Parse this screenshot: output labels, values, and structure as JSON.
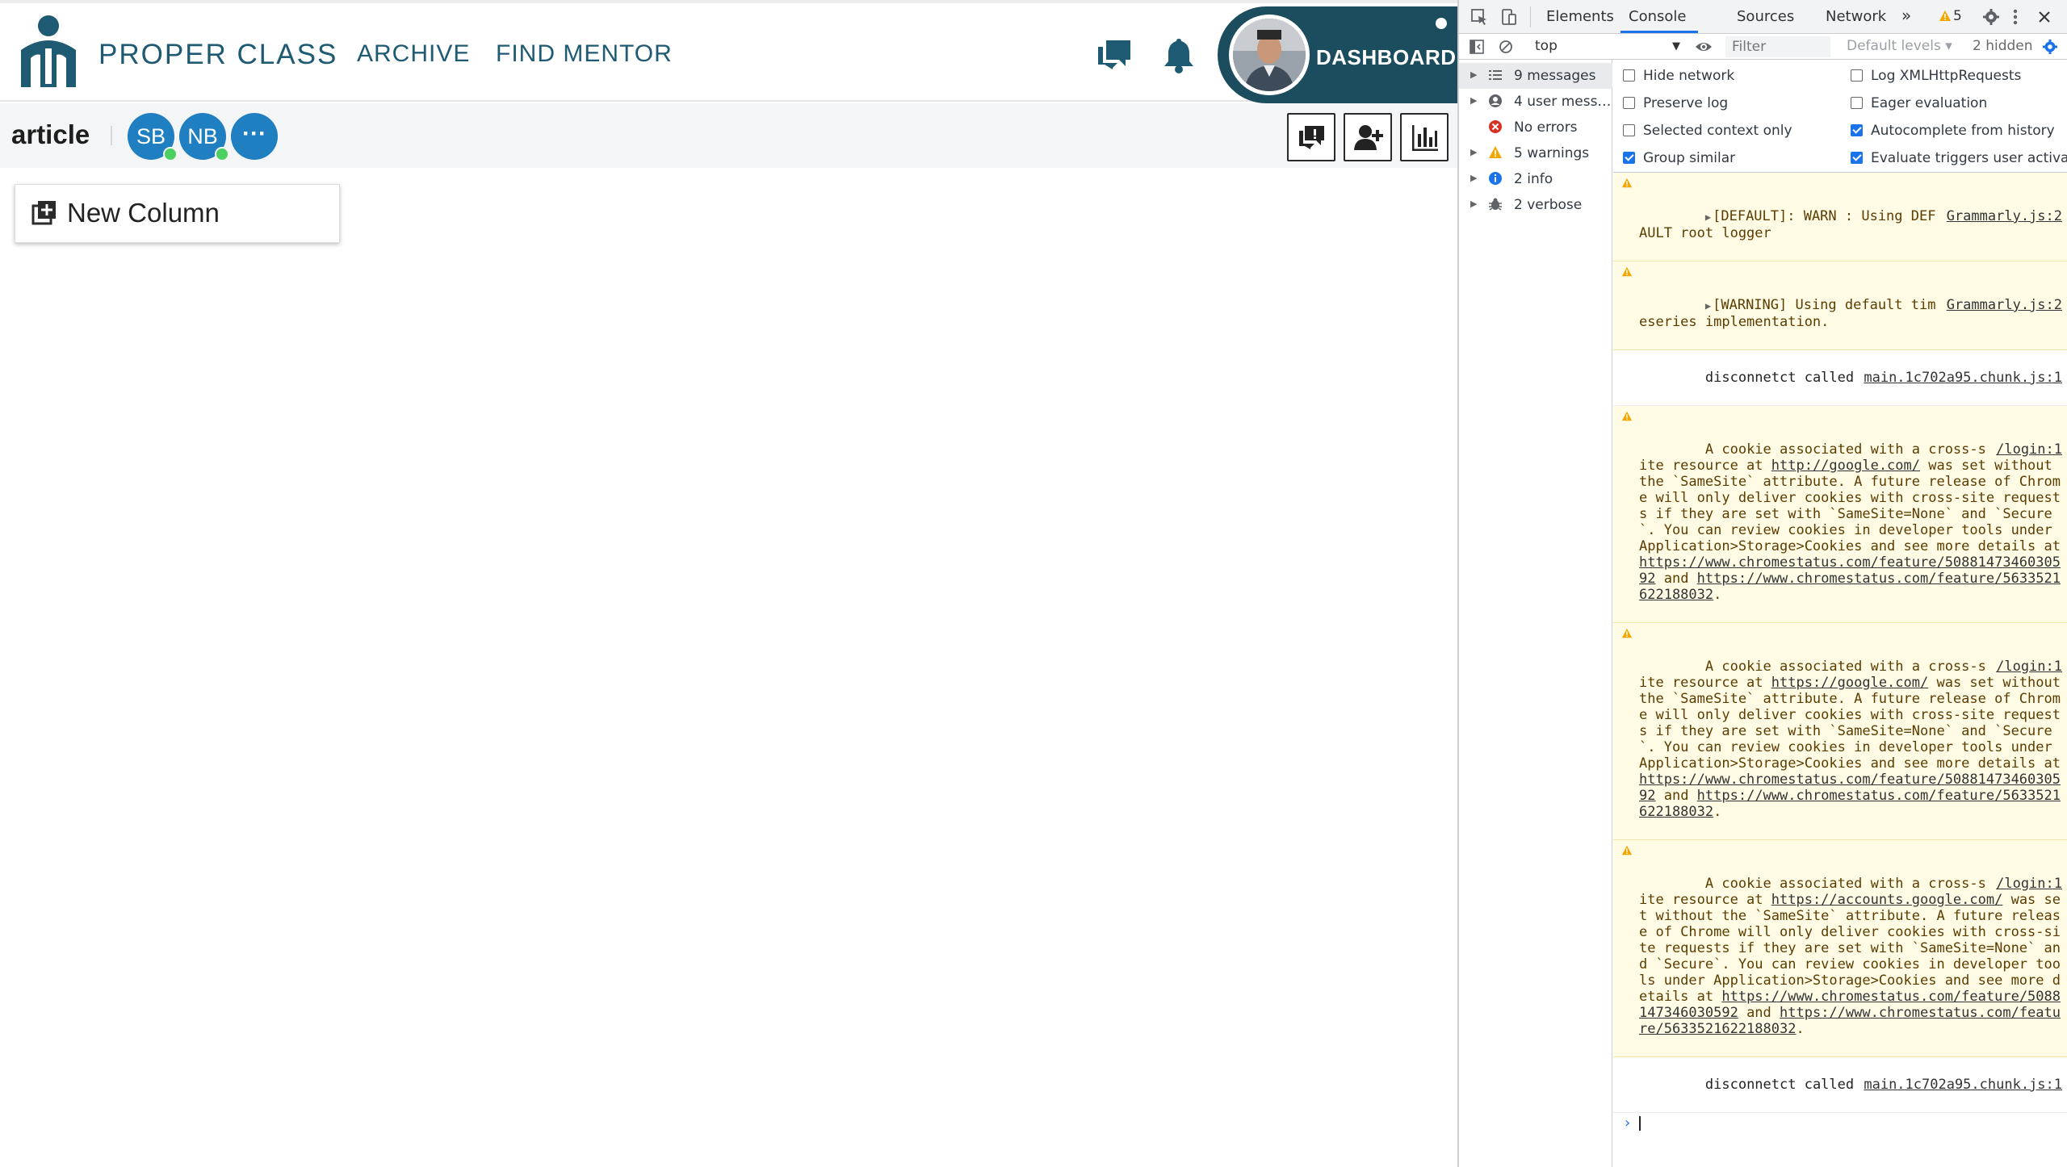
{
  "app": {
    "brand": "PROPER CLASS",
    "nav": {
      "archive": "ARCHIVE",
      "find_mentor": "FIND MENTOR"
    },
    "dashboard_label": "DASHBOARD",
    "article_title": "article",
    "members": [
      {
        "initials": "SB",
        "online": true
      },
      {
        "initials": "NB",
        "online": true
      }
    ],
    "more_members": "···",
    "new_column_label": "New Column",
    "colors": {
      "brand": "#1f5a73",
      "dashboard_bg": "#1c4d5e",
      "member_avatar": "#1f7fc0",
      "online": "#4ccf63"
    }
  },
  "devtools": {
    "tabs": [
      "Elements",
      "Console",
      "Sources",
      "Network",
      "»"
    ],
    "active_tab": "Console",
    "warning_badge": "5",
    "context": "top",
    "filter_placeholder": "Filter",
    "levels": "Default levels ▾",
    "hidden": "2 hidden",
    "sidebar": [
      {
        "label": "9 messages",
        "icon": "list-icon"
      },
      {
        "label": "4 user mess…",
        "icon": "user-icon"
      },
      {
        "label": "No errors",
        "icon": "error-icon"
      },
      {
        "label": "5 warnings",
        "icon": "warning-icon"
      },
      {
        "label": "2 info",
        "icon": "info-icon"
      },
      {
        "label": "2 verbose",
        "icon": "bug-icon"
      }
    ],
    "settings": {
      "hide_network": "Hide network",
      "preserve_log": "Preserve log",
      "selected_context": "Selected context only",
      "group_similar": "Group similar",
      "log_xhr": "Log XMLHttpRequests",
      "eager_eval": "Eager evaluation",
      "autocomplete": "Autocomplete from history",
      "evaluate_triggers": "Evaluate triggers user activatio"
    },
    "messages": [
      {
        "level": "warn",
        "expandable": true,
        "text": "[DEFAULT]: WARN : Using DEFAULT root logger",
        "source": "Grammarly.js:2"
      },
      {
        "level": "warn",
        "expandable": true,
        "text": "[WARNING] Using default timeseries implementation.",
        "source": "Grammarly.js:2"
      },
      {
        "level": "log",
        "text": "disconnetct called",
        "source": "main.1c702a95.chunk.js:1"
      },
      {
        "level": "warn",
        "text_a": "A cookie associated with a cross-site resource at ",
        "link": "http://google.com/",
        "text_b": " was set without the `SameSite` attribute. A future release of Chrome will only deliver cookies with cross-site requests if they are set with `SameSite=None` and `Secure`. You can review cookies in developer tools under Application>Storage>Cookies and see more details at ",
        "link2": "https://www.chromestatus.com/feature/5088147346030592",
        "text_c": " and ",
        "link3": "https://www.chromestatus.com/feature/5633521622188032",
        "text_d": ".",
        "source": "/login:1"
      },
      {
        "level": "warn",
        "text_a": "A cookie associated with a cross-site resource at ",
        "link": "https://google.com/",
        "text_b": " was set without the `SameSite` attribute. A future release of Chrome will only deliver cookies with cross-site requests if they are set with `SameSite=None` and `Secure`. You can review cookies in developer tools under Application>Storage>Cookies and see more details at ",
        "link2": "https://www.chromestatus.com/feature/5088147346030592",
        "text_c": " and ",
        "link3": "https://www.chromestatus.com/feature/5633521622188032",
        "text_d": ".",
        "source": "/login:1"
      },
      {
        "level": "warn",
        "text_a": "A cookie associated with a cross-site resource at ",
        "link": "https://accounts.google.com/",
        "text_b": " was set without the `SameSite` attribute. A future release of Chrome will only deliver cookies with cross-site requests if they are set with `SameSite=None` and `Secure`. You can review cookies in developer tools under Application>Storage>Cookies and see more details at ",
        "link2": "https://www.chromestatus.com/feature/5088147346030592",
        "text_c": " and ",
        "link3": "https://www.chromestatus.com/feature/5633521622188032",
        "text_d": ".",
        "source": "/login:1"
      },
      {
        "level": "log",
        "text": "disconnetct called",
        "source": "main.1c702a95.chunk.js:1"
      }
    ],
    "prompt_symbol": "›"
  }
}
